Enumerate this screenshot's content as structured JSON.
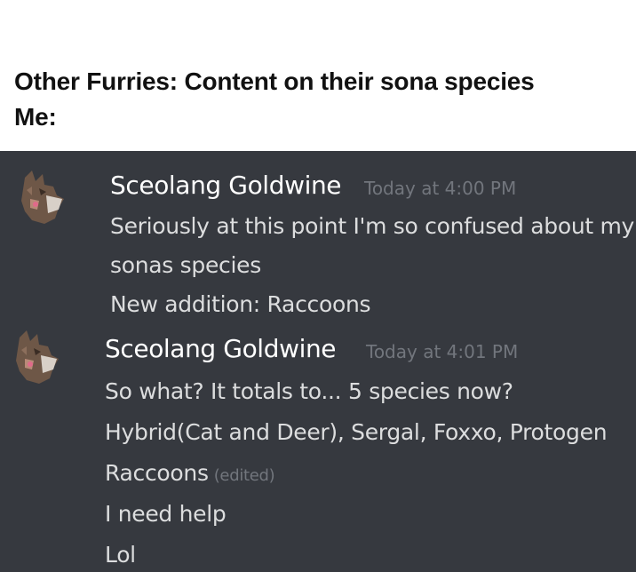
{
  "meme": {
    "line1": "Other Furries: Content on their sona species",
    "line2": "Me:"
  },
  "messages": [
    {
      "author": "Sceolang Goldwine",
      "timestamp": "Today at 4:00 PM",
      "lines": [
        "Seriously at this point I'm so confused about my",
        "sonas species",
        "New addition: Raccoons"
      ]
    },
    {
      "author": "Sceolang Goldwine",
      "timestamp": "Today at 4:01 PM",
      "lines": [
        "So what? It totals to... 5 species now?",
        "Hybrid(Cat and Deer), Sergal, Foxxo, Protogen",
        "Raccoons",
        "I need help",
        "Lol"
      ],
      "edited_label": "(edited)"
    }
  ],
  "colors": {
    "chat_background": "#36393f",
    "author_text": "#ffffff",
    "message_text": "#dcddde",
    "timestamp_text": "#72767d"
  },
  "icons": {
    "avatar": "furry-avatar-icon"
  }
}
